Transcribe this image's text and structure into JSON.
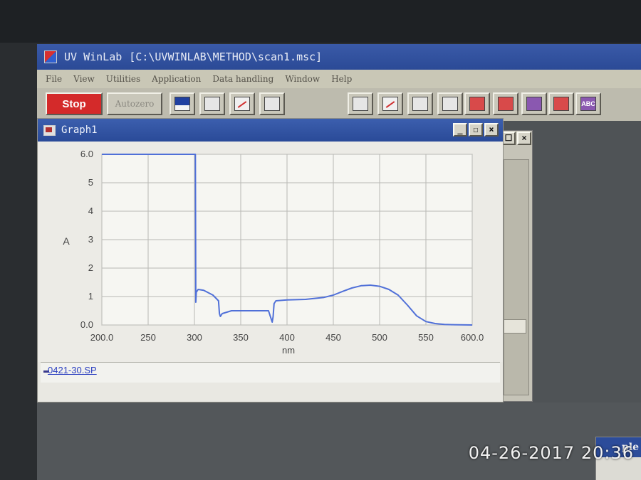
{
  "app": {
    "title": "UV WinLab",
    "path": "[C:\\UVWINLAB\\METHOD\\scan1.msc]"
  },
  "menu": [
    "File",
    "View",
    "Utilities",
    "Application",
    "Data handling",
    "Window",
    "Help"
  ],
  "toolbar": {
    "stop_label": "Stop",
    "autozero_label": "Autozero",
    "abc_label": "ABC",
    "stop_color": "#d42a2a"
  },
  "graph_window": {
    "title": "Graph1",
    "minimize": "_",
    "maximize": "☐",
    "close": "×",
    "legend_file": "0421-30.SP"
  },
  "background_window": {
    "restore": "☐",
    "close": "×"
  },
  "corner_window": {
    "title": "ple"
  },
  "timestamp": "04-26-2017 20:36",
  "chart_data": {
    "type": "line",
    "xlabel": "nm",
    "ylabel": "A",
    "xlim": [
      200,
      600
    ],
    "ylim": [
      0,
      6
    ],
    "x_ticks": [
      "200.0",
      "250",
      "300",
      "350",
      "400",
      "450",
      "500",
      "550",
      "600.0"
    ],
    "y_ticks": [
      "0.0",
      "1",
      "2",
      "3",
      "4",
      "5",
      "6.0"
    ],
    "grid": true,
    "line_color": "#5070d8",
    "series": [
      {
        "x": [
          200,
          301,
          301.5,
          302,
          304,
          310,
          320,
          326,
          327,
          328,
          330,
          340,
          360,
          380,
          384,
          385,
          386,
          388,
          400,
          420,
          440,
          450,
          460,
          470,
          480,
          490,
          500,
          510,
          520,
          530,
          540,
          550,
          560,
          570,
          580,
          600
        ],
        "y": [
          6.0,
          6.0,
          0.8,
          1.15,
          1.25,
          1.22,
          1.05,
          0.85,
          0.4,
          0.3,
          0.4,
          0.5,
          0.5,
          0.5,
          0.1,
          0.3,
          0.75,
          0.85,
          0.88,
          0.9,
          0.97,
          1.05,
          1.18,
          1.3,
          1.38,
          1.4,
          1.36,
          1.25,
          1.05,
          0.7,
          0.32,
          0.12,
          0.05,
          0.02,
          0.01,
          0.0
        ]
      }
    ]
  }
}
